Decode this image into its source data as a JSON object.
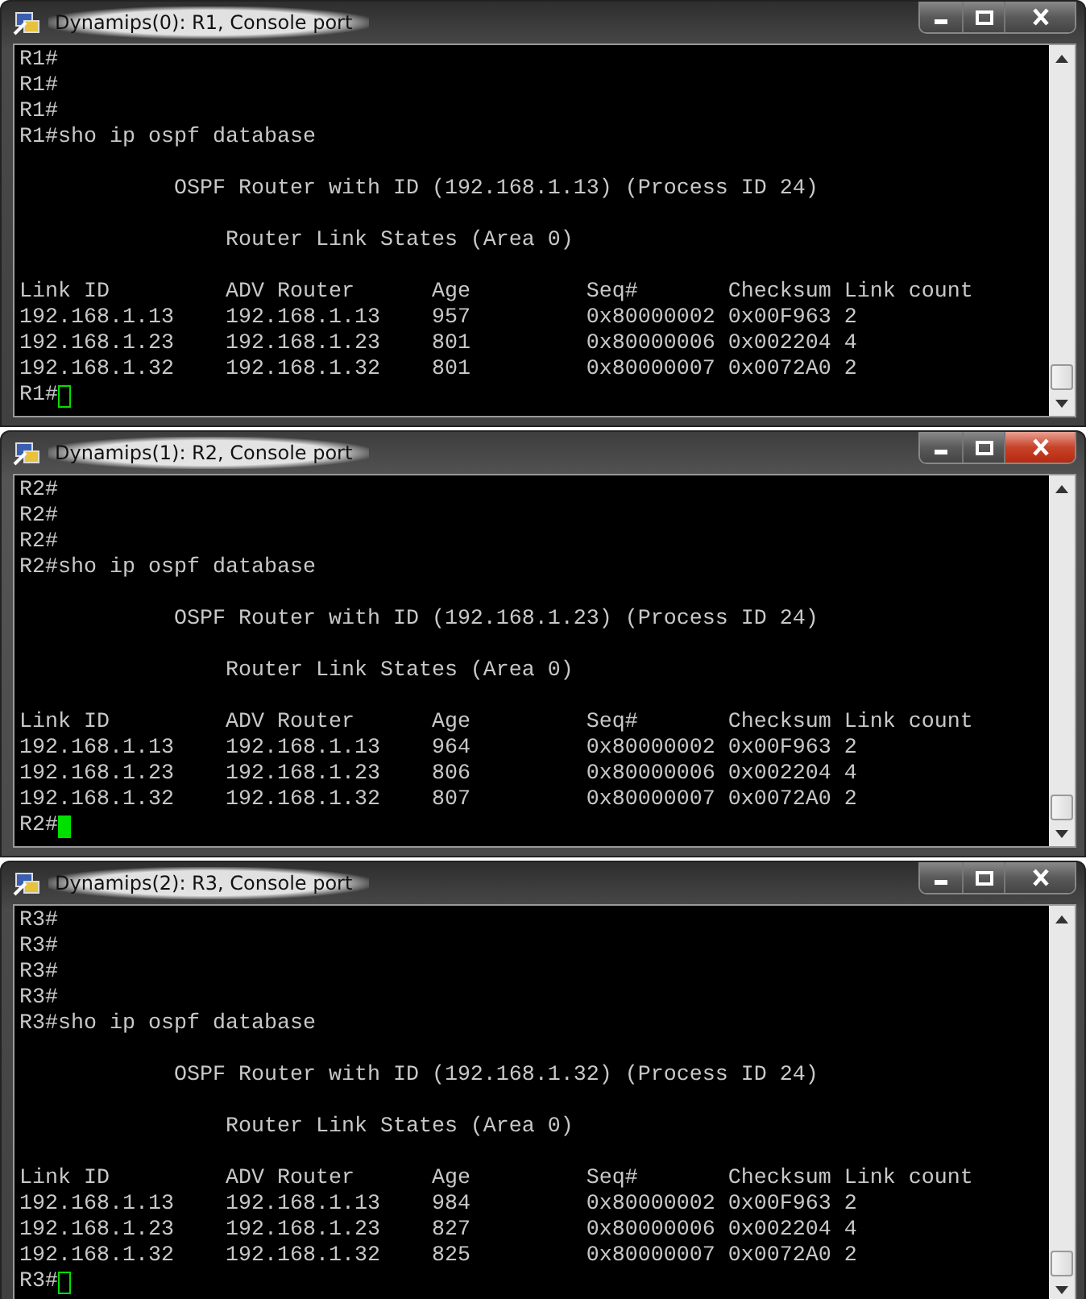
{
  "windows": [
    {
      "title": "Dynamips(0): R1, Console port",
      "active": false,
      "prompt": "R1#",
      "lines": [
        {
          "kind": "text",
          "text": "R1#"
        },
        {
          "kind": "text",
          "text": "R1#"
        },
        {
          "kind": "text",
          "text": "R1#"
        },
        {
          "kind": "text",
          "text": "R1#sho ip ospf database"
        },
        {
          "kind": "blank"
        },
        {
          "kind": "text",
          "text": "            OSPF Router with ID (192.168.1.13) (Process ID 24)"
        },
        {
          "kind": "blank"
        },
        {
          "kind": "text",
          "text": "                Router Link States (Area 0)"
        },
        {
          "kind": "blank"
        },
        {
          "kind": "text",
          "text": "Link ID         ADV Router      Age         Seq#       Checksum Link count"
        },
        {
          "kind": "text",
          "text": "192.168.1.13    192.168.1.13    957         0x80000002 0x00F963 2"
        },
        {
          "kind": "text",
          "text": "192.168.1.23    192.168.1.23    801         0x80000006 0x002204 4"
        },
        {
          "kind": "text",
          "text": "192.168.1.32    192.168.1.32    801         0x80000007 0x0072A0 2"
        }
      ]
    },
    {
      "title": "Dynamips(1): R2, Console port",
      "active": true,
      "prompt": "R2#",
      "lines": [
        {
          "kind": "text",
          "text": "R2#"
        },
        {
          "kind": "text",
          "text": "R2#"
        },
        {
          "kind": "text",
          "text": "R2#"
        },
        {
          "kind": "text",
          "text": "R2#sho ip ospf database"
        },
        {
          "kind": "blank"
        },
        {
          "kind": "text",
          "text": "            OSPF Router with ID (192.168.1.23) (Process ID 24)"
        },
        {
          "kind": "blank"
        },
        {
          "kind": "text",
          "text": "                Router Link States (Area 0)"
        },
        {
          "kind": "blank"
        },
        {
          "kind": "text",
          "text": "Link ID         ADV Router      Age         Seq#       Checksum Link count"
        },
        {
          "kind": "text",
          "text": "192.168.1.13    192.168.1.13    964         0x80000002 0x00F963 2"
        },
        {
          "kind": "text",
          "text": "192.168.1.23    192.168.1.23    806         0x80000006 0x002204 4"
        },
        {
          "kind": "text",
          "text": "192.168.1.32    192.168.1.32    807         0x80000007 0x0072A0 2"
        }
      ]
    },
    {
      "title": "Dynamips(2): R3, Console port",
      "active": false,
      "prompt": "R3#",
      "lines": [
        {
          "kind": "text",
          "text": "R3#"
        },
        {
          "kind": "text",
          "text": "R3#"
        },
        {
          "kind": "text",
          "text": "R3#"
        },
        {
          "kind": "text",
          "text": "R3#"
        },
        {
          "kind": "text",
          "text": "R3#sho ip ospf database"
        },
        {
          "kind": "blank"
        },
        {
          "kind": "text",
          "text": "            OSPF Router with ID (192.168.1.32) (Process ID 24)"
        },
        {
          "kind": "blank"
        },
        {
          "kind": "text",
          "text": "                Router Link States (Area 0)"
        },
        {
          "kind": "blank"
        },
        {
          "kind": "text",
          "text": "Link ID         ADV Router      Age         Seq#       Checksum Link count"
        },
        {
          "kind": "text",
          "text": "192.168.1.13    192.168.1.13    984         0x80000002 0x00F963 2"
        },
        {
          "kind": "text",
          "text": "192.168.1.23    192.168.1.23    827         0x80000006 0x002204 4"
        },
        {
          "kind": "text",
          "text": "192.168.1.32    192.168.1.32    825         0x80000007 0x0072A0 2"
        }
      ]
    }
  ]
}
